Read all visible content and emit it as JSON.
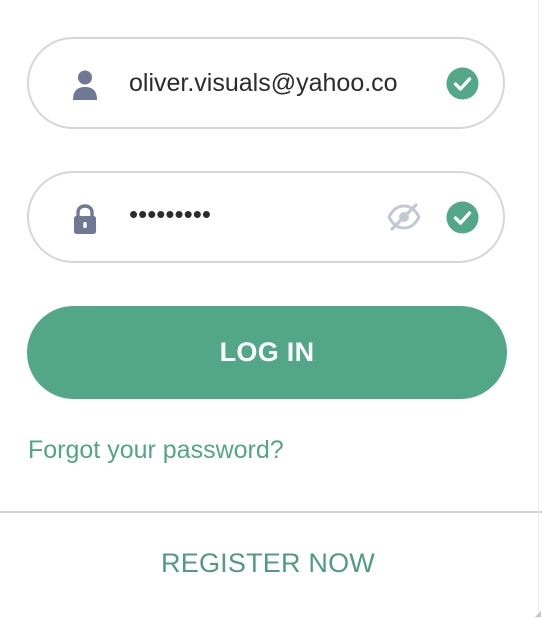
{
  "login_form": {
    "email": {
      "value": "oliver.visuals@yahoo.co",
      "leading_icon": "user-icon",
      "status_icon": "check-circle-icon"
    },
    "password": {
      "value": "•••••••••",
      "leading_icon": "lock-icon",
      "visibility_icon": "eye-off-icon",
      "status_icon": "check-circle-icon"
    },
    "login_button_label": "LOG IN",
    "forgot_password_label": "Forgot your password?",
    "register_label": "REGISTER NOW"
  },
  "colors": {
    "accent": "#51a787",
    "link": "#52a685",
    "field_border": "#d6d6d6",
    "icon_slate": "#6e7a93",
    "eye_icon": "#c3c9d3"
  }
}
